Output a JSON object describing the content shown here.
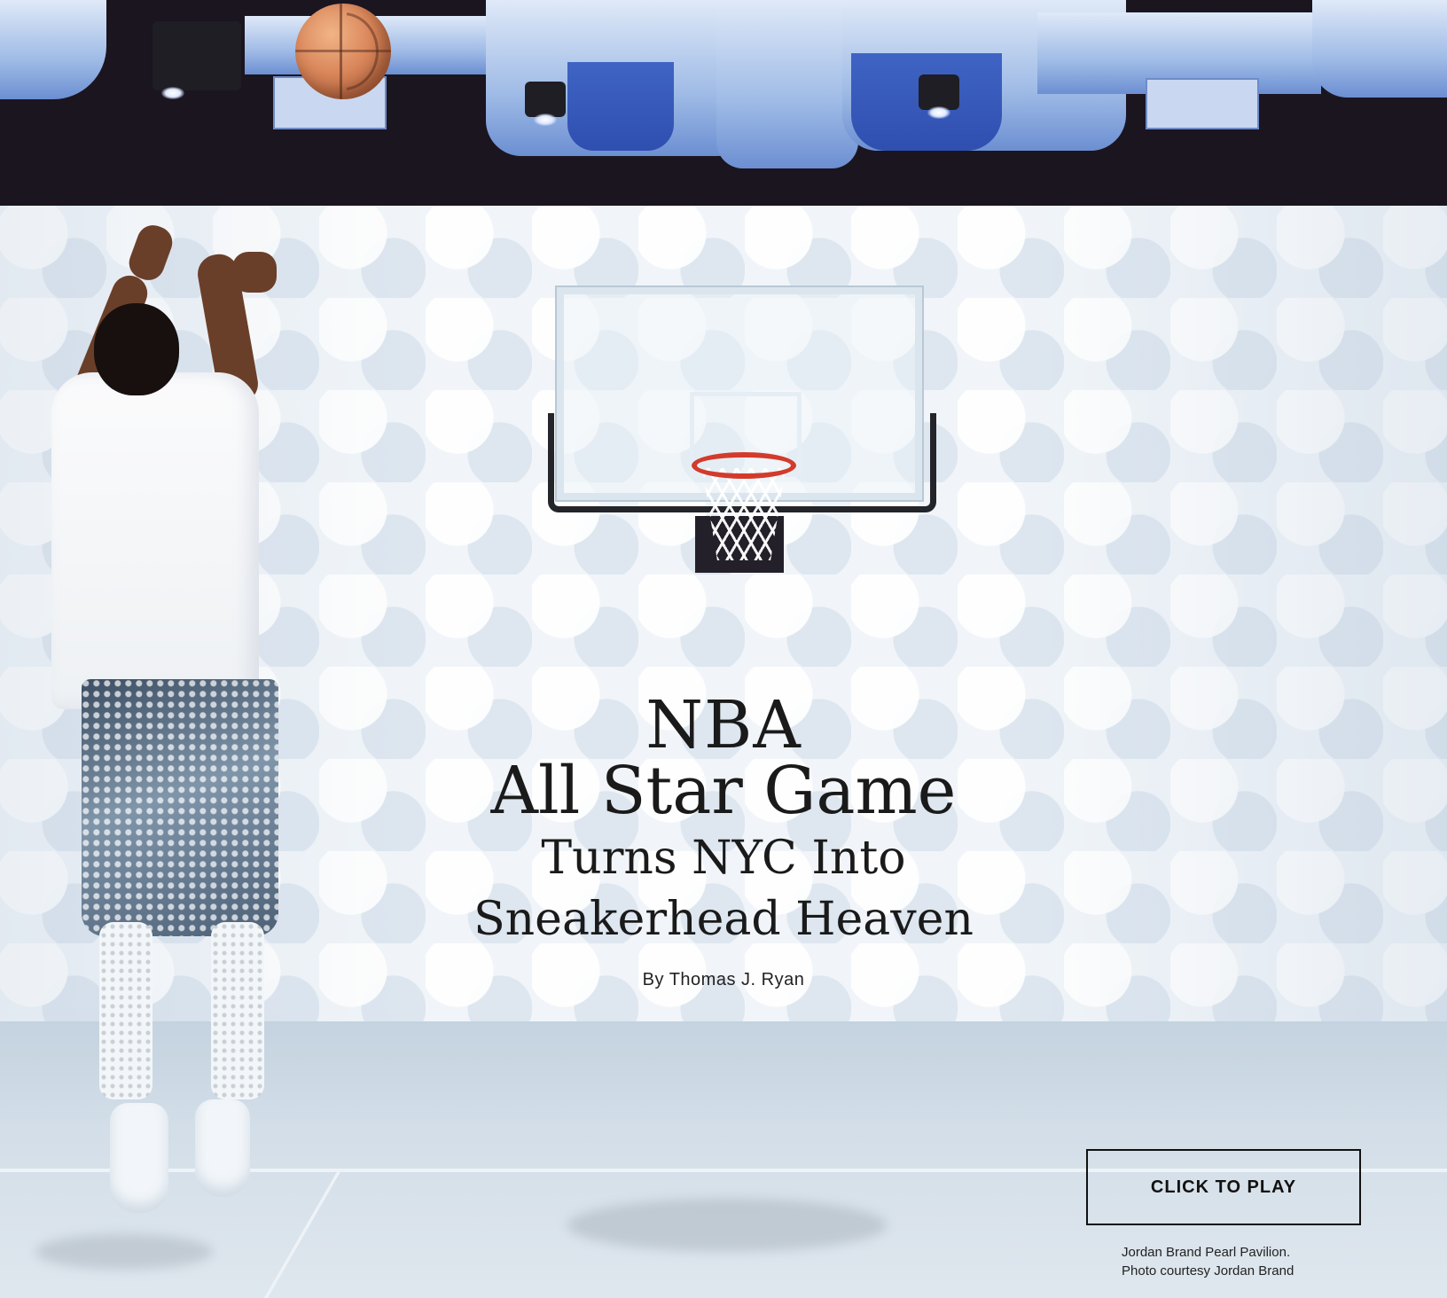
{
  "article": {
    "title_line1": "NBA",
    "title_line2": "All Star Game",
    "title_line3": "Turns NYC Into",
    "title_line4": "Sneakerhead Heaven",
    "byline": "By Thomas J. Ryan"
  },
  "media": {
    "play_label": "CLICK TO PLAY",
    "caption_line1": "Jordan Brand Pearl Pavilion.",
    "caption_line2": "Photo courtesy Jordan Brand"
  },
  "colors": {
    "ceiling": "#1b1520",
    "duct_blue": "#6c8fd2",
    "wall": "#f1f5f9",
    "rim_red": "#d23b2c",
    "text": "#1a1a1a"
  },
  "icons": [
    "basketball-icon"
  ]
}
